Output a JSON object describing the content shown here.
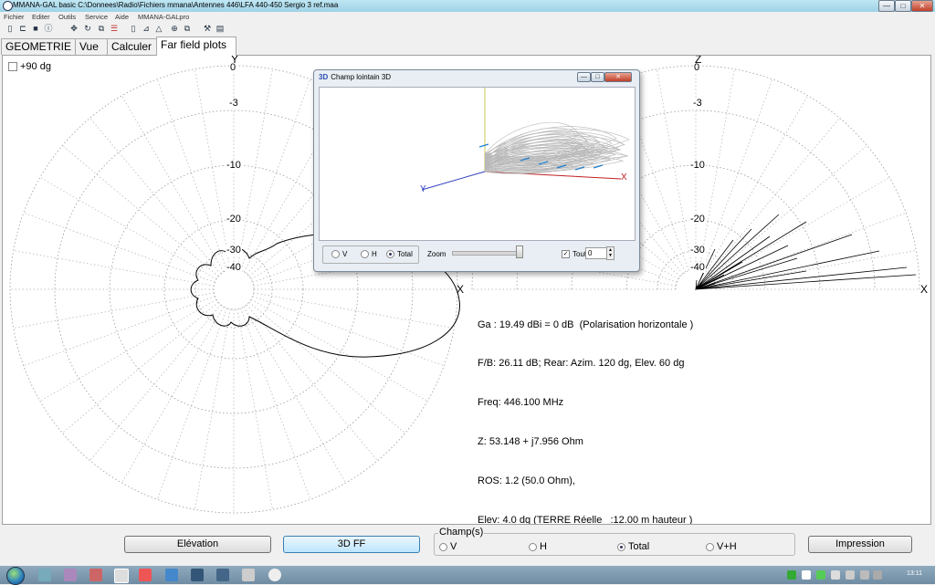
{
  "window": {
    "title": "MMANA-GAL basic C:\\Donnees\\Radio\\Fichiers mmana\\Antennes 446\\LFA 440-450 Sergio 3 ref.maa",
    "minimize": "—",
    "maximize": "□",
    "close": "✕"
  },
  "menu": [
    "Fichier",
    "Editer",
    "Outils",
    "Service",
    "Aide",
    "MMANA-GALpro"
  ],
  "toolbar_icons": [
    "new-icon",
    "open-icon",
    "save-icon",
    "info-icon",
    "move-icon",
    "rotate-icon",
    "copy-icon",
    "wire-icon",
    "page-icon",
    "edit-icon",
    "triangle-icon",
    "circle-target-icon",
    "duplicate-icon",
    "tools-icon",
    "table-icon"
  ],
  "tabs": [
    {
      "label": "GEOMETRIE",
      "active": false
    },
    {
      "label": "Vue",
      "active": false
    },
    {
      "label": "Calculer",
      "active": false
    },
    {
      "label": "Far field plots",
      "active": true
    }
  ],
  "plot": {
    "checkbox_label": "+90 dg",
    "checkbox_checked": false,
    "left_y_label": "Y",
    "left_x_label": "X",
    "right_z_label": "Z",
    "right_x_label": "X",
    "ticks_left": [
      "0",
      "-3",
      "-10",
      "-20",
      "-30",
      "-40"
    ],
    "ticks_right": [
      "0",
      "-3",
      "-10",
      "-20",
      "-30",
      "-40"
    ],
    "readout": [
      "Ga : 19.49 dBi = 0 dB  (Polarisation horizontale )",
      "F/B: 26.11 dB; Rear: Azim. 120 dg, Elev. 60 dg",
      "Freq: 446.100 MHz",
      "Z: 53.148 + j7.956 Ohm",
      "ROS: 1.2 (50.0 Ohm),",
      "Elev: 4.0 dg (TERRE Réelle   :12.00 m hauteur )"
    ]
  },
  "win3d": {
    "title": "Champ lointain 3D",
    "title_icon": "3D",
    "options": [
      {
        "label": "V",
        "selected": false
      },
      {
        "label": "H",
        "selected": false
      },
      {
        "label": "Total",
        "selected": true
      }
    ],
    "zoom_label": "Zoom",
    "tout_label": "Tout",
    "tout_checked": true,
    "tout_value": "0",
    "axis_y": "Y",
    "axis_x": "X"
  },
  "bottom": {
    "elevation_button": "Elévation",
    "ff3d_button": "3D FF",
    "champs_legend": "Champ(s)",
    "champs_options": [
      {
        "label": "V",
        "selected": false
      },
      {
        "label": "H",
        "selected": false
      },
      {
        "label": "Total",
        "selected": true
      },
      {
        "label": "V+H",
        "selected": false
      }
    ],
    "print_button": "Impression"
  },
  "taskbar": {
    "clock": "13:11",
    "apps": [
      "explorer-icon",
      "library-icon",
      "recycle-icon",
      "paint-icon",
      "media-icon",
      "browser-icon",
      "tool-icon",
      "app-icon",
      "app2-icon",
      "app3-icon",
      "mmana-icon"
    ]
  }
}
